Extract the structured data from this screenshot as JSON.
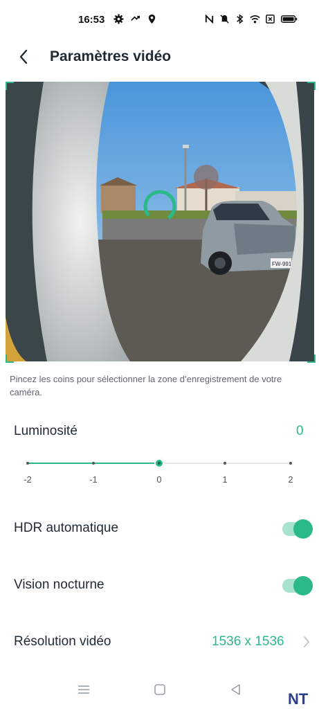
{
  "status_bar": {
    "time": "16:53",
    "left_icons": [
      "gear-icon",
      "connection-icon",
      "location-icon"
    ],
    "right_icons": [
      "nfc-icon",
      "mute-icon",
      "bluetooth-icon",
      "wifi-icon",
      "sim-icon",
      "battery-icon"
    ]
  },
  "header": {
    "back_icon": "chevron-left-icon",
    "title": "Paramètres vidéo"
  },
  "preview": {
    "plate_text": "FW-991",
    "accent": "#2bb98a"
  },
  "hint": "Pincez les coins pour sélectionner la zone d’enregistrement de votre caméra.",
  "brightness": {
    "label": "Luminosité",
    "value": "0",
    "current": 0,
    "min": -2,
    "max": 2,
    "ticks": [
      "-2",
      "-1",
      "0",
      "1",
      "2"
    ]
  },
  "hdr": {
    "label": "HDR automatique",
    "on": true
  },
  "night_vision": {
    "label": "Vision nocturne",
    "on": true
  },
  "resolution": {
    "label": "Résolution vidéo",
    "value": "1536 x 1536"
  },
  "nav_bar": [
    "menu-icon",
    "home-square-icon",
    "back-triangle-icon"
  ],
  "watermark": "NT",
  "colors": {
    "accent": "#2bb98a",
    "toggle_track": "#a9e2cd",
    "text": "#1f2933",
    "hint": "#5f6770"
  }
}
